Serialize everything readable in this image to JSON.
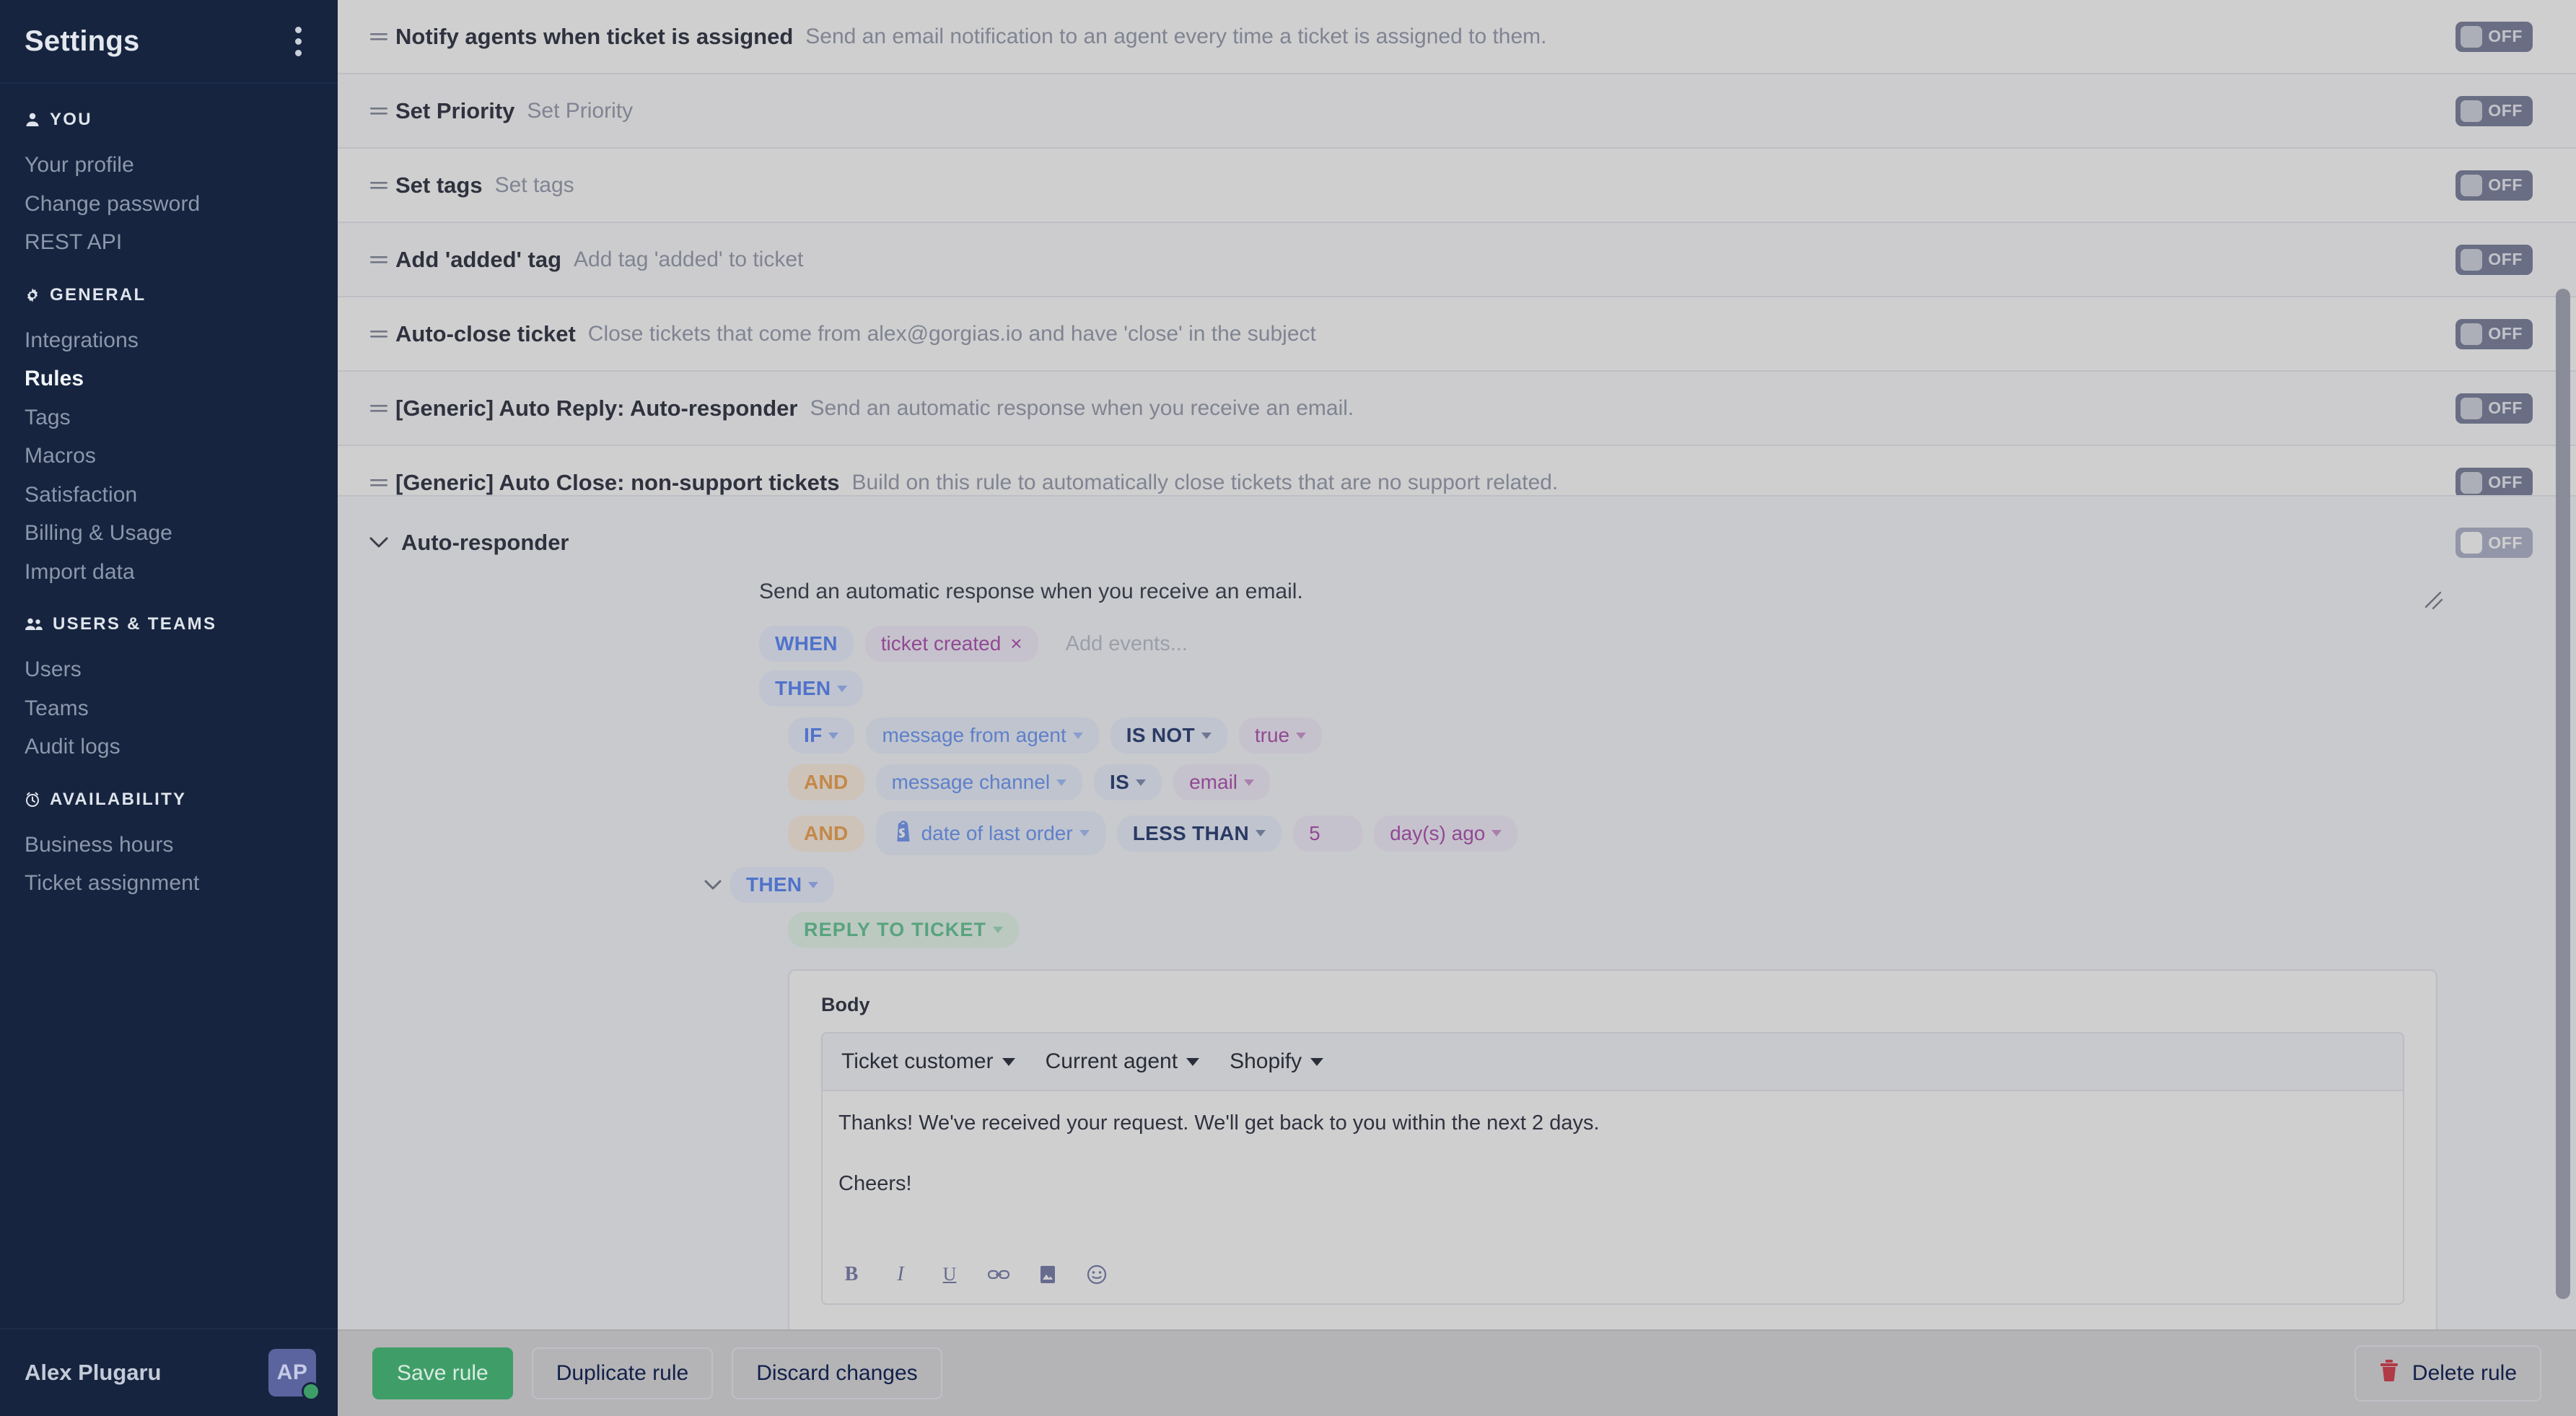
{
  "sidebar": {
    "title": "Settings",
    "groups": [
      {
        "icon": "person-icon",
        "label": "YOU",
        "items": [
          {
            "label": "Your profile",
            "active": false
          },
          {
            "label": "Change password",
            "active": false
          },
          {
            "label": "REST API",
            "active": false
          }
        ]
      },
      {
        "icon": "gear-icon",
        "label": "GENERAL",
        "items": [
          {
            "label": "Integrations",
            "active": false
          },
          {
            "label": "Rules",
            "active": true
          },
          {
            "label": "Tags",
            "active": false
          },
          {
            "label": "Macros",
            "active": false
          },
          {
            "label": "Satisfaction",
            "active": false
          },
          {
            "label": "Billing & Usage",
            "active": false
          },
          {
            "label": "Import data",
            "active": false
          }
        ]
      },
      {
        "icon": "people-icon",
        "label": "USERS & TEAMS",
        "items": [
          {
            "label": "Users",
            "active": false
          },
          {
            "label": "Teams",
            "active": false
          },
          {
            "label": "Audit logs",
            "active": false
          }
        ]
      },
      {
        "icon": "clock-icon",
        "label": "AVAILABILITY",
        "items": [
          {
            "label": "Business hours",
            "active": false
          },
          {
            "label": "Ticket assignment",
            "active": false
          }
        ]
      }
    ],
    "user": {
      "name": "Alex Plugaru",
      "initials": "AP",
      "status": "online"
    }
  },
  "rules": [
    {
      "name": "Notify agents when ticket is assigned",
      "desc": "Send an email notification to an agent every time a ticket is assigned to them.",
      "toggle": "OFF"
    },
    {
      "name": "Set Priority",
      "desc": "Set Priority",
      "toggle": "OFF"
    },
    {
      "name": "Set tags",
      "desc": "Set tags",
      "toggle": "OFF"
    },
    {
      "name": "Add 'added' tag",
      "desc": "Add tag 'added' to ticket",
      "toggle": "OFF"
    },
    {
      "name": "Auto-close ticket",
      "desc": "Close tickets that come from alex@gorgias.io and have 'close' in the subject",
      "toggle": "OFF"
    },
    {
      "name": "[Generic] Auto Reply: Auto-responder",
      "desc": "Send an automatic response when you receive an email.",
      "toggle": "OFF"
    },
    {
      "name": "[Generic] Auto Close: non-support tickets",
      "desc": "Build on this rule to automatically close tickets that are no support related.",
      "toggle": "OFF"
    }
  ],
  "panel": {
    "title": "Auto-responder",
    "toggle": "OFF",
    "description": "Send an automatic response when you receive an email.",
    "when": {
      "keyword": "WHEN",
      "events": [
        {
          "label": "ticket created",
          "remove": "×"
        }
      ],
      "placeholder": "Add events..."
    },
    "then": {
      "keyword": "THEN"
    },
    "conditions": [
      {
        "connector": "IF",
        "connector_caret": true,
        "icon": null,
        "field": "message from agent",
        "operator": "IS NOT",
        "value": "true",
        "extra": null
      },
      {
        "connector": "AND",
        "connector_caret": false,
        "icon": null,
        "field": "message channel",
        "operator": "IS",
        "value": "email",
        "extra": null
      },
      {
        "connector": "AND",
        "connector_caret": false,
        "icon": "shopify-icon",
        "field": "date of last order",
        "operator": "LESS THAN",
        "value": "5",
        "extra": "day(s) ago"
      }
    ],
    "then2": {
      "keyword": "THEN"
    },
    "action": {
      "label": "REPLY TO TICKET"
    },
    "editor": {
      "label": "Body",
      "variables": [
        {
          "label": "Ticket customer"
        },
        {
          "label": "Current agent"
        },
        {
          "label": "Shopify"
        }
      ],
      "body_lines": [
        "Thanks! We've received your request. We'll get back to you within the next 2 days.",
        "Cheers!"
      ],
      "format_buttons": [
        {
          "name": "bold-icon",
          "glyph": "B"
        },
        {
          "name": "italic-icon",
          "glyph": "I"
        },
        {
          "name": "underline-icon",
          "glyph": "U"
        },
        {
          "name": "link-icon",
          "glyph": "⚭"
        },
        {
          "name": "image-icon",
          "glyph": "▣"
        },
        {
          "name": "emoji-icon",
          "glyph": "☺"
        }
      ]
    }
  },
  "footer": {
    "save": "Save rule",
    "duplicate": "Duplicate rule",
    "discard": "Discard changes",
    "delete": "Delete rule"
  },
  "colors": {
    "sidebar_bg": "#16243f",
    "accent_blue": "#4a7cf7",
    "accent_purple": "#a63fa8",
    "accent_green": "#3f9e68",
    "accent_orange": "#ef9a3e",
    "delete_red": "#b03a46"
  }
}
